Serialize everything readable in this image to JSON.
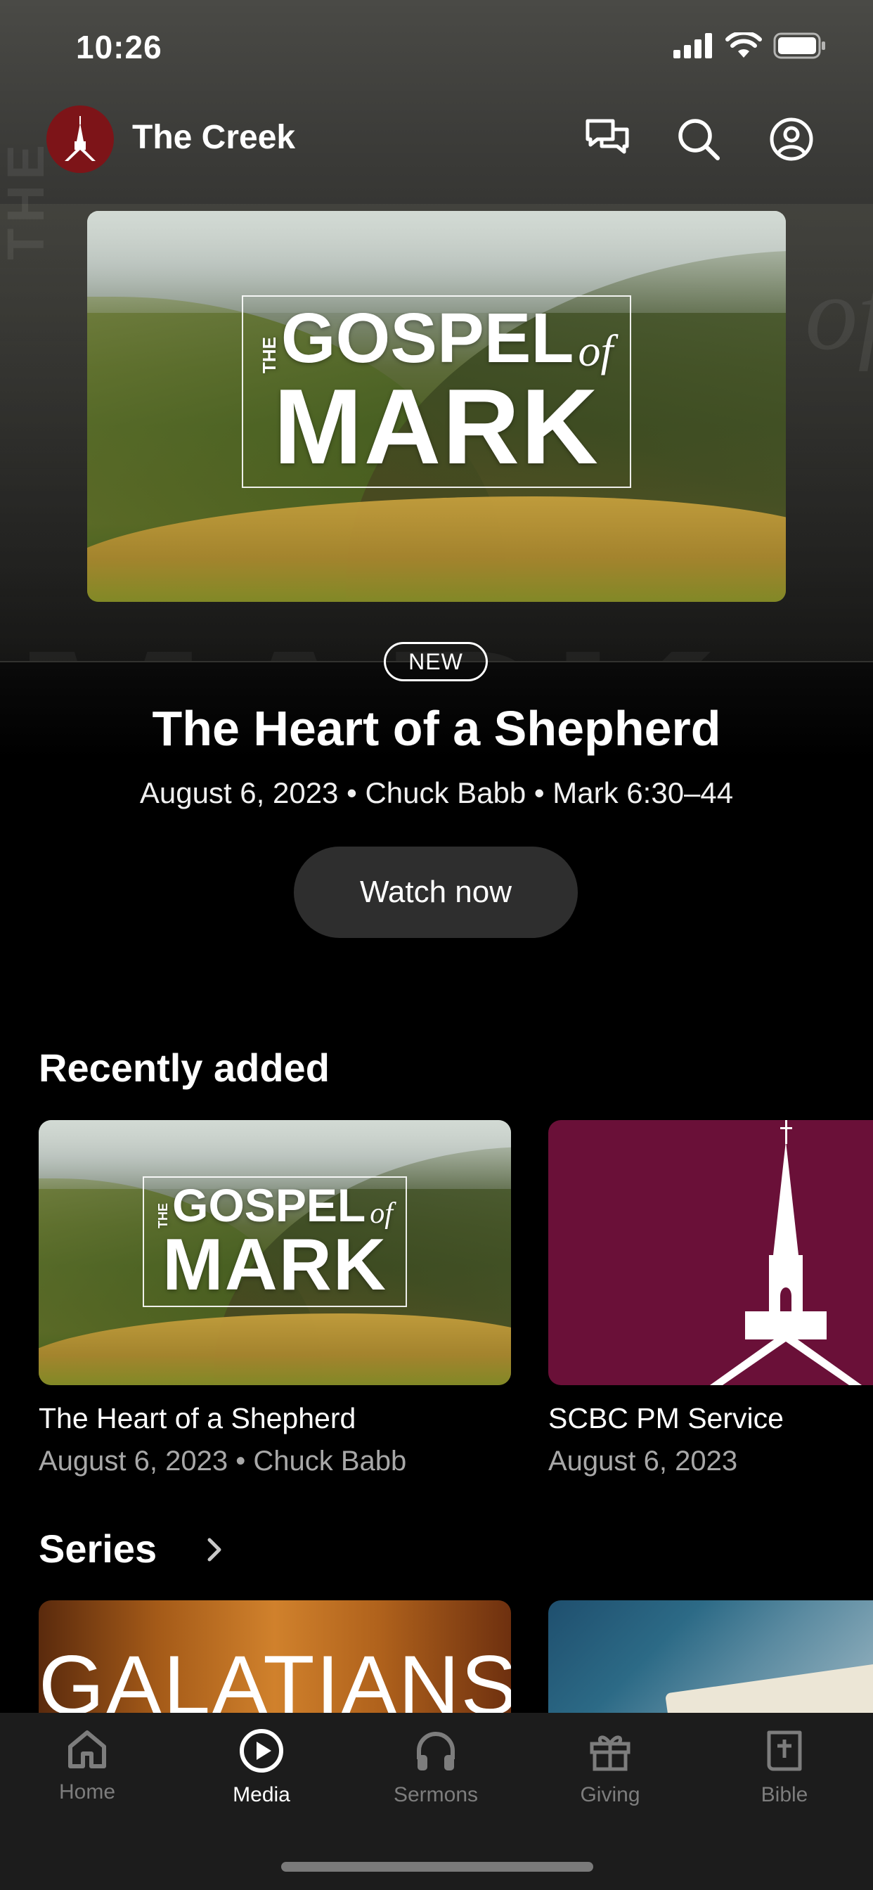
{
  "status_bar": {
    "time": "10:26"
  },
  "header": {
    "brand_name": "The Creek"
  },
  "hero_artwork": {
    "the": "THE",
    "gospel": "GOSPEL",
    "of": "of",
    "mark": "MARK"
  },
  "featured": {
    "badge": "NEW",
    "title": "The Heart of a Shepherd",
    "meta": "August 6, 2023 • Chuck Babb • Mark 6:30–44",
    "watch_label": "Watch now"
  },
  "recently_added": {
    "title": "Recently added",
    "items": [
      {
        "title": "The Heart of a Shepherd",
        "subtitle": "August 6, 2023 • Chuck Babb"
      },
      {
        "title": "SCBC PM Service",
        "subtitle": "August 6, 2023"
      }
    ]
  },
  "series": {
    "title": "Series",
    "items": [
      {
        "artwork_text": "GALATIANS"
      }
    ]
  },
  "tab_bar": {
    "active": "Media",
    "items": [
      {
        "label": "Home",
        "icon": "home-icon"
      },
      {
        "label": "Media",
        "icon": "play-circle-icon"
      },
      {
        "label": "Sermons",
        "icon": "headphones-icon"
      },
      {
        "label": "Giving",
        "icon": "gift-icon"
      },
      {
        "label": "Bible",
        "icon": "bible-icon"
      }
    ]
  },
  "colors": {
    "brand_red": "#7d1418",
    "scbc_maroon": "#6a1038",
    "button_bg": "#2e2e2e",
    "tab_inactive": "#7d7d7d"
  }
}
